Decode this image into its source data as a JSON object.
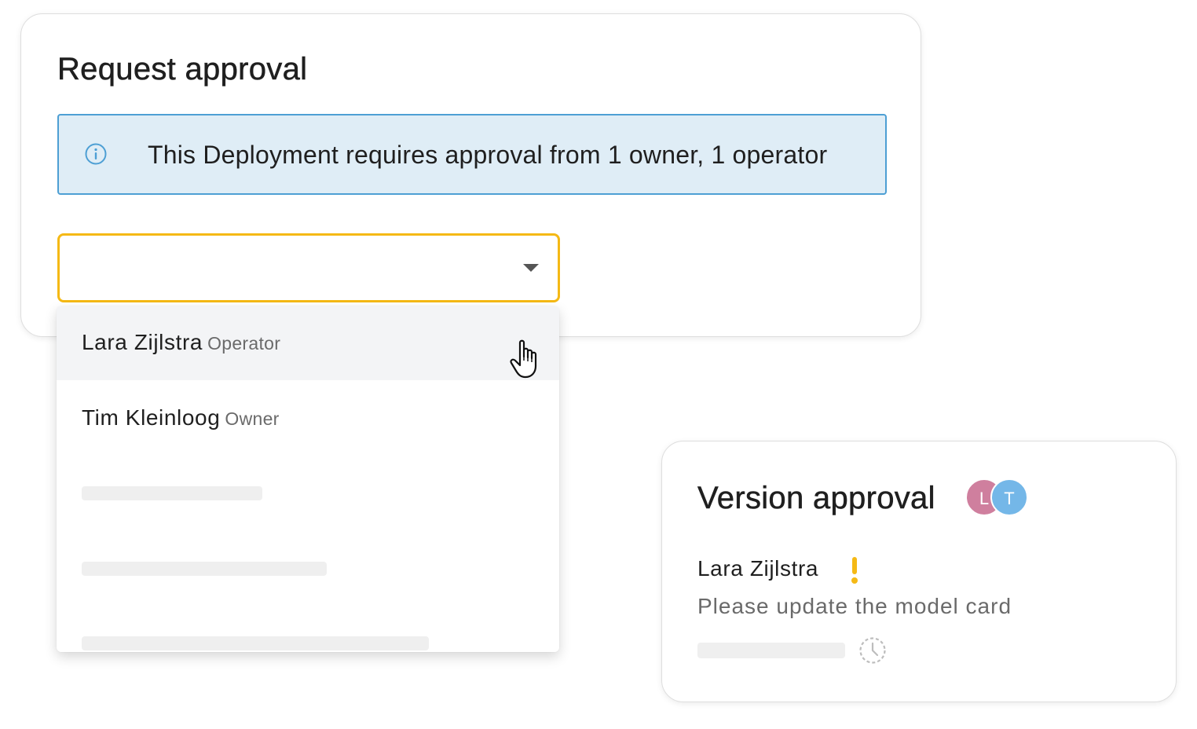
{
  "request_approval": {
    "title": "Request approval",
    "info_banner": {
      "icon": "info-icon",
      "text": "This Deployment requires approval from 1 owner, 1 operator"
    },
    "approver_select": {
      "value": "",
      "icon": "chevron-down-icon"
    },
    "dropdown": {
      "options": [
        {
          "name": "Lara Zijlstra",
          "role": "Operator",
          "hovered": true
        },
        {
          "name": "Tim Kleinloog",
          "role": "Owner",
          "hovered": false
        }
      ],
      "loading_placeholders": 3
    }
  },
  "version_approval": {
    "title": "Version approval",
    "avatars": [
      {
        "initial": "L",
        "color": "#cf7f9e"
      },
      {
        "initial": "T",
        "color": "#74b7e8"
      }
    ],
    "approver": {
      "name": "Lara Zijlstra",
      "status_icon": "warning-icon",
      "comment": "Please update the model card"
    },
    "pending_icon": "clock-icon"
  },
  "colors": {
    "accent_yellow": "#f5b915",
    "info_blue": "#4d9fd4",
    "info_background": "#dfedf6"
  }
}
